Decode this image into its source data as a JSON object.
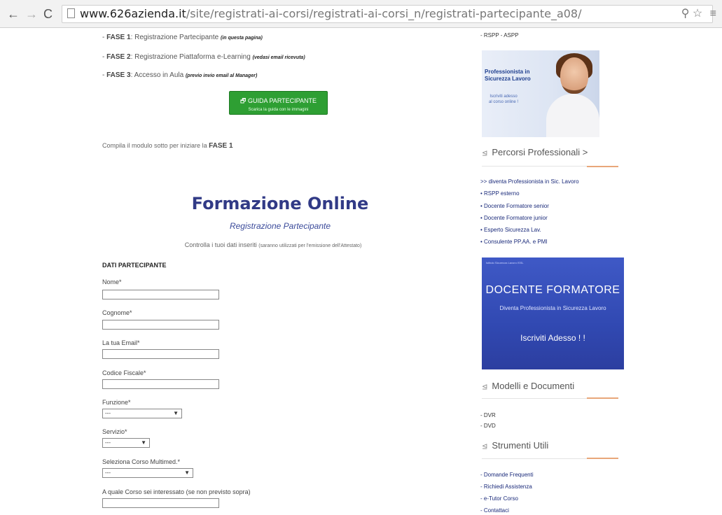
{
  "browser": {
    "url_domain": "www.626azienda.it",
    "url_path": "/site/registrati-ai-corsi/registrati-ai-corsi_n/registrati-partecipante_a08/"
  },
  "phases": [
    {
      "label": "- ",
      "bold": "FASE 1",
      "text": ": Registrazione Partecipante ",
      "note": "(in questa pagina)"
    },
    {
      "label": "- ",
      "bold": "FASE 2",
      "text": ": Registrazione Piattaforma e-Learning ",
      "note": "(vedasi email ricevuta)"
    },
    {
      "label": "- ",
      "bold": "FASE 3",
      "text": ": Accesso in Aula ",
      "note": "(previo invio email al Manager)"
    }
  ],
  "guide_button": {
    "title": "GUIDA PARTECIPANTE",
    "subtitle": "Scarica la guida con le immagini"
  },
  "intro": {
    "text": "Compila il modulo sotto per iniziare la ",
    "bold": "FASE 1"
  },
  "form": {
    "title": "Formazione Online",
    "subtitle": "Registrazione Partecipante",
    "note": "Controlla i tuoi dati inseriti ",
    "note_small": "(saranno utilizzati per l'emissione dell'Attestato)",
    "section": "DATI PARTECIPANTE",
    "fields": {
      "nome": "Nome*",
      "cognome": "Cognome*",
      "email": "La tua Email*",
      "cf": "Codice Fiscale*",
      "funzione": "Funzione*",
      "servizio": "Servizio*",
      "corso": "Seleziona Corso Multimed.*",
      "altro": "A quale Corso sei interessato (se non previsto sopra)"
    },
    "select_placeholder": "---"
  },
  "sidebar": {
    "top_item": "- RSPP - ASPP",
    "promo1": {
      "line1": "Professionista in",
      "line2": "Sicurezza Lavoro",
      "line3": "Iscriviti adesso",
      "line4": "al corso online !"
    },
    "percorsi": {
      "heading": "Percorsi Professionali >",
      "items": [
        ">> diventa Professionista in Sic. Lavoro",
        "• RSPP esterno",
        "• Docente Formatore senior",
        "• Docente Formatore junior",
        "• Esperto Sicurezza Lav.",
        "• Consulente PP.AA. e PMI"
      ]
    },
    "promo2": {
      "tiny": "Istituto Sicurezza Lavoro ISSL",
      "title": "DOCENTE FORMATORE",
      "subtitle": "Diventa Professionista in Sicurezza Lavoro",
      "cta": "Iscriviti Adesso ! !"
    },
    "modelli": {
      "heading": "Modelli e Documenti",
      "items": [
        "- DVR",
        "- DVD"
      ]
    },
    "strumenti": {
      "heading": "Strumenti Utili",
      "items": [
        "- Domande Frequenti",
        "- Richiedi Assistenza",
        "- e-Tutor Corso",
        "- Contattaci"
      ]
    }
  },
  "icons": {
    "back": "arrow-left-icon",
    "forward": "arrow-right-icon",
    "reload": "reload-icon",
    "page": "page-icon",
    "zoom": "zoom-icon",
    "star": "star-icon",
    "menu": "menu-icon"
  }
}
